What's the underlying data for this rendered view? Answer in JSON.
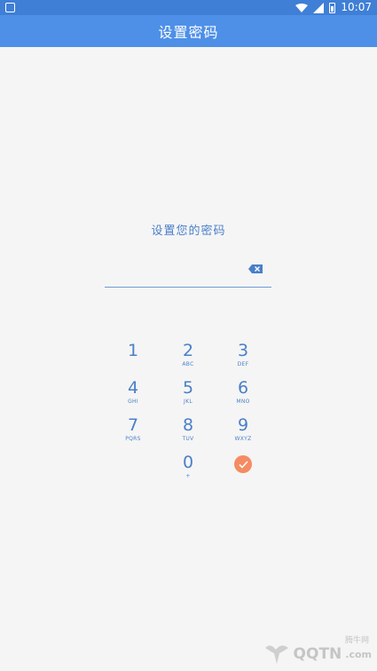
{
  "status_bar": {
    "time": "10:07",
    "icons": [
      "notification-icon",
      "wifi-icon",
      "signal-icon",
      "battery-icon"
    ]
  },
  "app_bar": {
    "title": "设置密码"
  },
  "prompt": {
    "text": "设置您的密码"
  },
  "pin_input": {
    "value": "",
    "backspace_icon": "backspace-icon"
  },
  "keypad": {
    "keys": [
      {
        "digit": "1",
        "letters": ""
      },
      {
        "digit": "2",
        "letters": "ABC"
      },
      {
        "digit": "3",
        "letters": "DEF"
      },
      {
        "digit": "4",
        "letters": "GHI"
      },
      {
        "digit": "5",
        "letters": "JKL"
      },
      {
        "digit": "6",
        "letters": "MNO"
      },
      {
        "digit": "7",
        "letters": "PQRS"
      },
      {
        "digit": "8",
        "letters": "TUV"
      },
      {
        "digit": "9",
        "letters": "WXYZ"
      },
      {
        "digit": "0",
        "letters": "+"
      }
    ],
    "confirm_icon": "check-icon",
    "confirm_color": "#f58b62"
  },
  "watermark": {
    "brand": "QQTN",
    "suffix": ".com",
    "site": "腾牛网"
  },
  "colors": {
    "status_bar": "#3f7fd6",
    "app_bar": "#4e90e8",
    "accent": "#4a7fc9",
    "background": "#f5f5f5"
  }
}
